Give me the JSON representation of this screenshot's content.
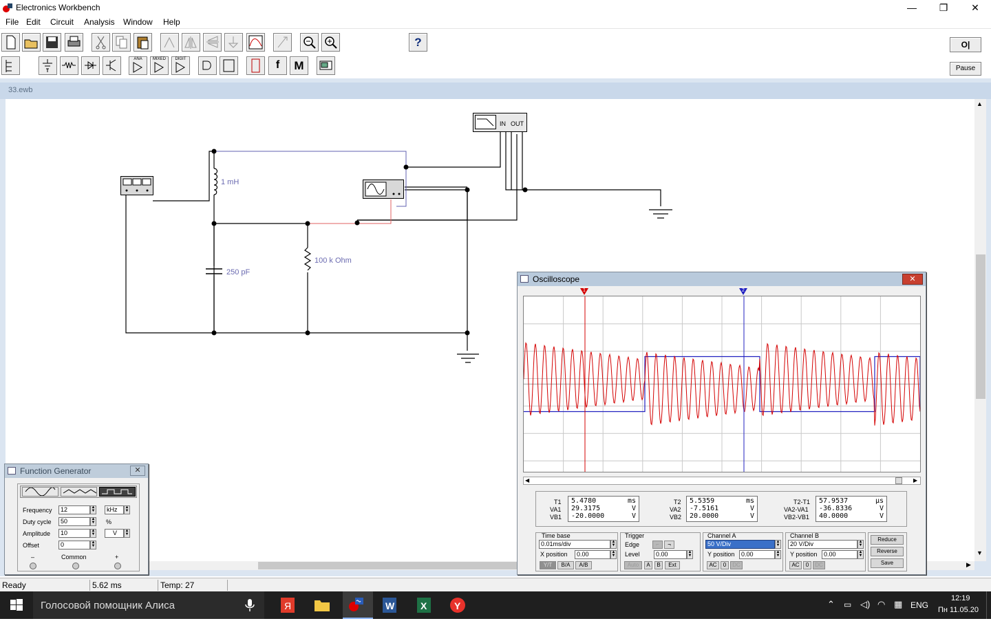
{
  "window": {
    "title": "Electronics Workbench",
    "minimize": "—",
    "maximize": "❐",
    "close": "✕"
  },
  "menu": [
    "File",
    "Edit",
    "Circuit",
    "Analysis",
    "Window",
    "Help"
  ],
  "toolbar": {
    "help_label": "?",
    "power_label": "O|",
    "pause_label": "Pause",
    "ana": "ANA",
    "mixed": "MIXED",
    "digit": "DIGIT",
    "misc_m": "M",
    "misc_f": "f"
  },
  "document": {
    "title": "33.ewb"
  },
  "circuit": {
    "inductor": "1 mH",
    "capacitor": "250 pF",
    "resistor": "100 k Ohm",
    "filter_in": "IN",
    "filter_out": "OUT"
  },
  "function_generator": {
    "title": "Function Generator",
    "frequency": {
      "label": "Frequency",
      "value": "12",
      "unit": "kHz"
    },
    "duty": {
      "label": "Duty cycle",
      "value": "50",
      "unit": "%"
    },
    "amplitude": {
      "label": "Amplitude",
      "value": "10",
      "unit": "V"
    },
    "offset": {
      "label": "Offset",
      "value": "0"
    },
    "terminals": {
      "minus": "–",
      "common": "Common",
      "plus": "+"
    }
  },
  "oscilloscope": {
    "title": "Oscilloscope",
    "t1": {
      "label": "T1",
      "value": "5.4780",
      "unit": "ms"
    },
    "va1": {
      "label": "VA1",
      "value": "29.3175",
      "unit": "V"
    },
    "vb1": {
      "label": "VB1",
      "value": "-20.0000",
      "unit": "V"
    },
    "t2": {
      "label": "T2",
      "value": "5.5359",
      "unit": "ms"
    },
    "va2": {
      "label": "VA2",
      "value": "-7.5161",
      "unit": "V"
    },
    "vb2": {
      "label": "VB2",
      "value": "20.0000",
      "unit": "V"
    },
    "t21": {
      "label": "T2-T1",
      "value": "57.9537",
      "unit": "µs"
    },
    "va21": {
      "label": "VA2-VA1",
      "value": "-36.8336",
      "unit": "V"
    },
    "vb21": {
      "label": "VB2-VB1",
      "value": "40.0000",
      "unit": "V"
    },
    "timebase": {
      "label": "Time base",
      "value": "0.01ms/div",
      "xpos_label": "X position",
      "xpos": "0.00",
      "yt": "Y/T",
      "ba": "B/A",
      "ab": "A/B"
    },
    "trigger": {
      "label": "Trigger",
      "edge": "Edge",
      "level_label": "Level",
      "level": "0.00",
      "auto": "Auto",
      "a": "A",
      "b": "B",
      "ext": "Ext"
    },
    "channel_a": {
      "label": "Channel A",
      "value": "50 V/Div",
      "ypos_label": "Y position",
      "ypos": "0.00",
      "ac": "AC",
      "zero": "0",
      "dc": "DC"
    },
    "channel_b": {
      "label": "Channel B",
      "value": "20 V/Div",
      "ypos_label": "Y position",
      "ypos": "0.00",
      "ac": "AC",
      "zero": "0",
      "dc": "DC"
    },
    "buttons": {
      "reduce": "Reduce",
      "reverse": "Reverse",
      "save": "Save"
    },
    "cursor1": "1",
    "cursor2": "2"
  },
  "status": {
    "ready": "Ready",
    "time": "5.62 ms",
    "temp": "Temp:  27"
  },
  "taskbar": {
    "search": "Голосовой помощник Алиса",
    "lang": "ENG",
    "time": "12:19",
    "date": "Пн 11.05.20"
  },
  "colors": {
    "channel_a": "#d40000",
    "channel_b": "#2020c0",
    "grid": "#c8c8c8",
    "wire": "#000000"
  }
}
